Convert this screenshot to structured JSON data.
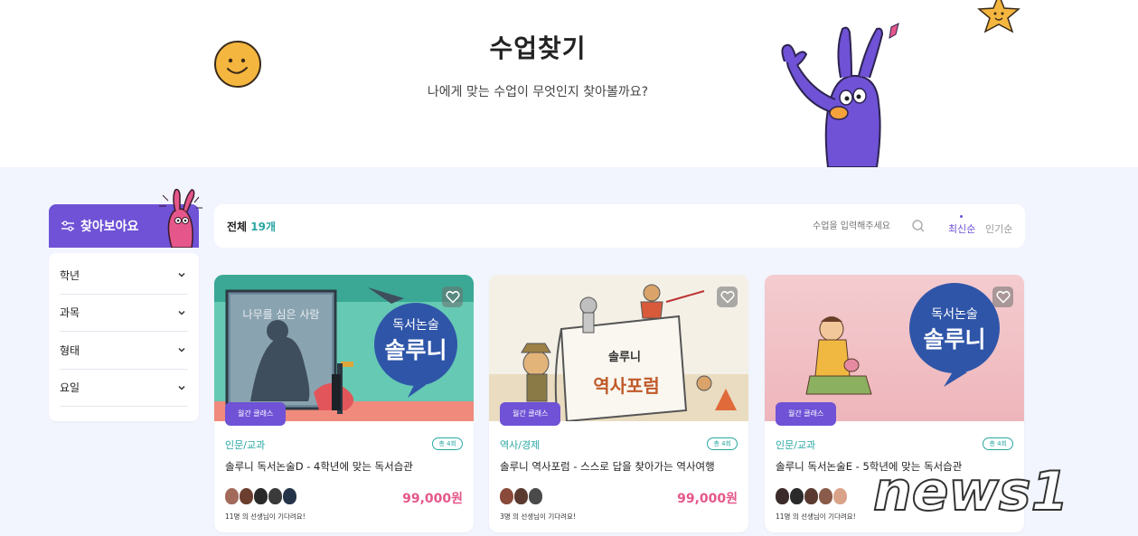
{
  "hero": {
    "title": "수업찾기",
    "subtitle": "나에게 맞는 수업이 무엇인지 찾아볼까요?"
  },
  "sidebar": {
    "header": "찾아보아요",
    "filters": [
      {
        "label": "학년"
      },
      {
        "label": "과목"
      },
      {
        "label": "형태"
      },
      {
        "label": "요일"
      }
    ]
  },
  "toolbar": {
    "total_label": "전체",
    "total_count": "19개",
    "search_placeholder": "수업을 입력해주세요",
    "sort_latest": "최신순",
    "sort_popular": "인기순"
  },
  "cards": [
    {
      "badge": "월간 클래스",
      "category": "인문/교과",
      "sessions": "총 4회",
      "title": "솔루니 독서논술D - 4학년에 맞는 독서습관",
      "price": "99,000원",
      "waiting": "11명 의 선생님이 기다려요!",
      "thumb_text_1": "독서논술",
      "thumb_text_2": "솔루니",
      "thumb_book_title": "나무를 심은 사람"
    },
    {
      "badge": "월간 클래스",
      "category": "역사/경제",
      "sessions": "총 4회",
      "title": "솔루니 역사포럼 - 스스로 답을 찾아가는 역사여행",
      "price": "99,000원",
      "waiting": "3명 의 선생님이 기다려요!",
      "thumb_text_1": "솔루니",
      "thumb_text_2": "역사포럼"
    },
    {
      "badge": "월간 클래스",
      "category": "인문/교과",
      "sessions": "총 4회",
      "title": "솔루니 독서논술E - 5학년에 맞는 독서습관",
      "price": "",
      "waiting": "11명 의 선생님이 기다려요!",
      "thumb_text_1": "독서논술",
      "thumb_text_2": "솔루니"
    }
  ],
  "watermark": "news1",
  "colors": {
    "accent": "#6f52d6",
    "teal": "#29a7a3",
    "price": "#e5578a",
    "background": "#f2f5fd"
  }
}
